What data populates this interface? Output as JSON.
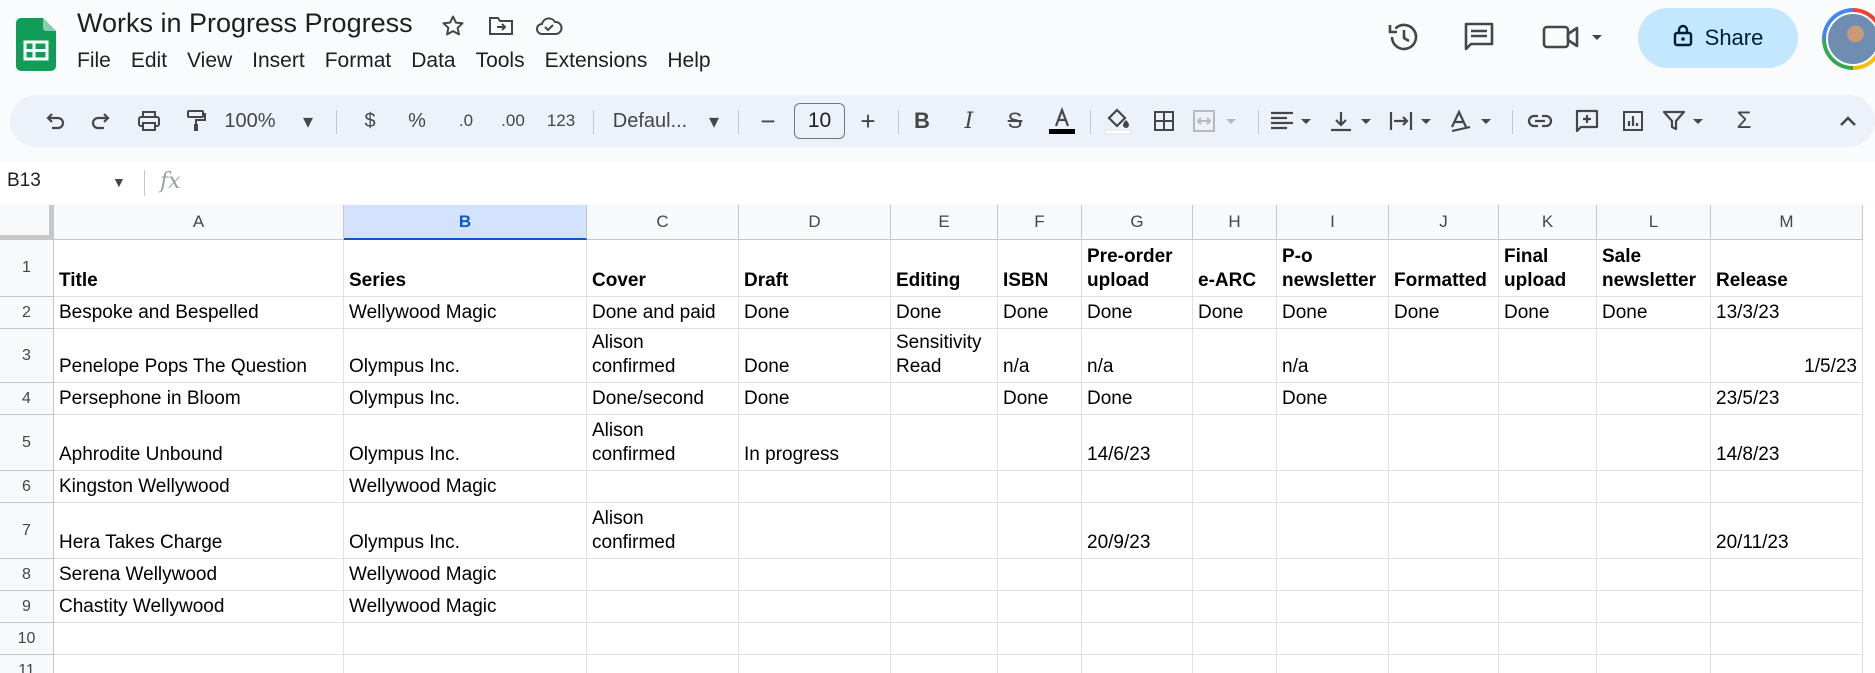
{
  "document": {
    "title": "Works in Progress Progress"
  },
  "menu": [
    "File",
    "Edit",
    "View",
    "Insert",
    "Format",
    "Data",
    "Tools",
    "Extensions",
    "Help"
  ],
  "share": {
    "label": "Share"
  },
  "toolbar": {
    "zoom": "100%",
    "currency": "$",
    "percent": "%",
    "decrease_decimal": ".0",
    "increase_decimal": ".00",
    "number_format": "123",
    "font": "Defaul...",
    "font_size": "10"
  },
  "formula_bar": {
    "name_box": "B13",
    "fx": "fx"
  },
  "grid": {
    "columns": [
      "A",
      "B",
      "C",
      "D",
      "E",
      "F",
      "G",
      "H",
      "I",
      "J",
      "K",
      "L",
      "M"
    ],
    "selected_column": "B",
    "row_numbers": [
      "1",
      "2",
      "3",
      "4",
      "5",
      "6",
      "7",
      "8",
      "9",
      "10",
      "11"
    ],
    "rows": [
      [
        "Title",
        "Series",
        "Cover",
        "Draft",
        "Editing",
        "ISBN",
        "Pre-order\nupload",
        "e-ARC",
        "P-o\nnewsletter",
        "Formatted",
        "Final\nupload",
        "Sale\nnewsletter",
        "Release"
      ],
      [
        "Bespoke and Bespelled",
        "Wellywood Magic",
        "Done and paid",
        "Done",
        "Done",
        "Done",
        "Done",
        "Done",
        "Done",
        "Done",
        "Done",
        "Done",
        "13/3/23"
      ],
      [
        "Penelope Pops The Question",
        "Olympus Inc.",
        "Alison\nconfirmed",
        "Done",
        "Sensitivity\nRead",
        "n/a",
        "n/a",
        "",
        "n/a",
        "",
        "",
        "",
        "1/5/23"
      ],
      [
        "Persephone in Bloom",
        "Olympus Inc.",
        "Done/second",
        "Done",
        "",
        "Done",
        "Done",
        "",
        "Done",
        "",
        "",
        "",
        "23/5/23"
      ],
      [
        "Aphrodite Unbound",
        "Olympus Inc.",
        "Alison\nconfirmed",
        "In progress",
        "",
        "",
        "14/6/23",
        "",
        "",
        "",
        "",
        "",
        "14/8/23"
      ],
      [
        "Kingston Wellywood",
        "Wellywood Magic",
        "",
        "",
        "",
        "",
        "",
        "",
        "",
        "",
        "",
        "",
        ""
      ],
      [
        "Hera Takes Charge",
        "Olympus Inc.",
        "Alison\nconfirmed",
        "",
        "",
        "",
        "20/9/23",
        "",
        "",
        "",
        "",
        "",
        "20/11/23"
      ],
      [
        "Serena Wellywood",
        "Wellywood Magic",
        "",
        "",
        "",
        "",
        "",
        "",
        "",
        "",
        "",
        "",
        ""
      ],
      [
        "Chastity Wellywood",
        "Wellywood Magic",
        "",
        "",
        "",
        "",
        "",
        "",
        "",
        "",
        "",
        "",
        ""
      ],
      [
        "",
        "",
        "",
        "",
        "",
        "",
        "",
        "",
        "",
        "",
        "",
        "",
        ""
      ],
      [
        "",
        "",
        "",
        "",
        "",
        "",
        "",
        "",
        "",
        "",
        "",
        "",
        ""
      ]
    ],
    "right_aligned_cells": [
      [
        2,
        12
      ]
    ]
  },
  "icons": [
    "sheets-logo-icon",
    "star-icon",
    "move-folder-icon",
    "cloud-saved-icon",
    "history-icon",
    "comments-icon",
    "meet-icon",
    "lock-icon",
    "undo-icon",
    "redo-icon",
    "print-icon",
    "paint-format-icon",
    "bold-icon",
    "italic-icon",
    "strikethrough-icon",
    "text-color-icon",
    "fill-color-icon",
    "borders-icon",
    "merge-cells-icon",
    "horizontal-align-icon",
    "vertical-align-icon",
    "text-wrap-icon",
    "text-rotation-icon",
    "insert-link-icon",
    "insert-comment-icon",
    "insert-chart-icon",
    "filter-icon",
    "functions-icon",
    "collapse-icon"
  ]
}
